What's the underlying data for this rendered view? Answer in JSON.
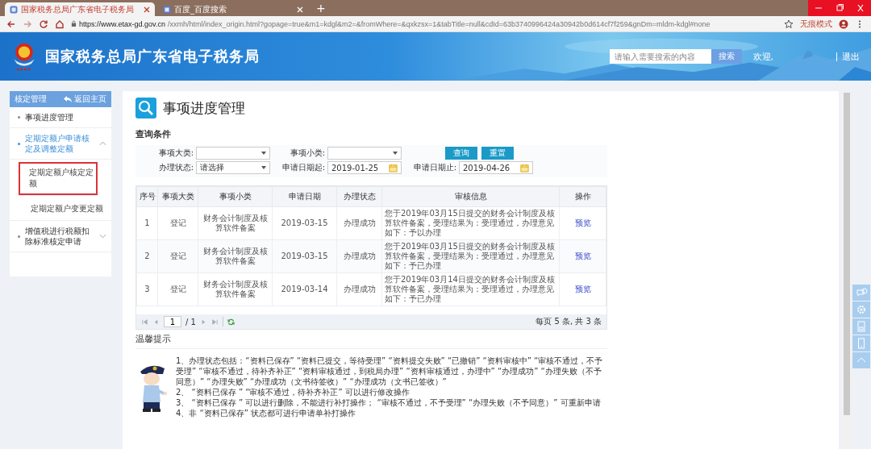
{
  "browser": {
    "tabs": [
      {
        "title": "国家税务总局广东省电子税务局",
        "selected": true
      },
      {
        "title": "百度_百度搜索",
        "selected": false
      }
    ],
    "new_tab": "+",
    "url_host": "https://www.etax-gd.gov.cn",
    "url_path": "/xxmh/html/index_origin.html?gopage=true&m1=kdgl&m2=&fromWhere=&qxkzsx=1&tabTitle=null&cdId=63b3740996424a30942b0d614cf7f259&gnDm=mldm-kdgl#none",
    "incognito": "无痕模式"
  },
  "header": {
    "title": "国家税务总局广东省电子税务局",
    "search_placeholder": "请输入需要搜索的内容",
    "search_button": "搜索",
    "welcome": "欢迎,",
    "logout": "退出"
  },
  "sidebar": {
    "title": "核定管理",
    "back": "返回主页",
    "items": [
      {
        "label": "事项进度管理",
        "selected": false
      },
      {
        "label": "定期定额户申请核定及调整定额",
        "selected": false,
        "expanded": true,
        "children": [
          {
            "label": "定期定额户核定定额",
            "selected": true
          },
          {
            "label": "定期定额户变更定额",
            "selected": false
          }
        ]
      },
      {
        "label": "增值税进行税额扣除标准核定申请",
        "selected": false,
        "expanded": false
      }
    ]
  },
  "page": {
    "title": "事项进度管理",
    "query_title": "查询条件",
    "filter_rows": [
      [
        {
          "label": "事项大类:",
          "kind": "select"
        },
        {
          "label": "事项小类:",
          "kind": "select"
        }
      ],
      [
        {
          "label": "办理状态:",
          "kind": "select",
          "value": "请选择"
        },
        {
          "label": "申请日期起:",
          "kind": "date",
          "value": "2019-01-25"
        },
        {
          "label": "申请日期止:",
          "kind": "date",
          "value": "2019-04-26"
        }
      ]
    ],
    "buttons": [
      "查询",
      "重置"
    ]
  },
  "table": {
    "columns": [
      "序号",
      "事项大类",
      "事项小类",
      "申请日期",
      "办理状态",
      "审核信息",
      "操作"
    ],
    "rows": [
      {
        "cells": [
          "1",
          "登记",
          "财务会计制度及核算软件备案",
          "2019-03-15",
          "办理成功",
          "您于2019年03月15日提交的财务会计制度及核算软件备案，受理结果为：受理通过，办理意见如下：予以办理"
        ],
        "action": "预览"
      },
      {
        "cells": [
          "2",
          "登记",
          "财务会计制度及核算软件备案",
          "2019-03-15",
          "办理成功",
          "您于2019年03月15日提交的财务会计制度及核算软件备案，受理结果为：受理通过，办理意见如下：予已办理"
        ],
        "action": "预览"
      },
      {
        "cells": [
          "3",
          "登记",
          "财务会计制度及核算软件备案",
          "2019-03-14",
          "办理成功",
          "您于2019年03月14日提交的财务会计制度及核算软件备案，受理结果为：受理通过，办理意见如下：予已办理"
        ],
        "action": "预览"
      }
    ]
  },
  "pager": {
    "page": "1",
    "total_pages": "/ 1",
    "summary": "每页 5 条, 共 3 条"
  },
  "tips": {
    "title": "温馨提示",
    "items": [
      "1、办理状态包括：“资料已保存” “资料已提交，等待受理” “资料提交失败” “已撤销” “资料审核中” “审核不通过，不予受理” “审核不通过，待补齐补正” “资料审核通过，到税局办理” “资料审核通过，办理中” “办理成功” “办理失败（不予同意）” “办理失败” “办理成功（文书待签收）” “办理成功（文书已签收）”",
      "2、 “资料已保存 ” “审核不通过，待补齐补正” 可以进行修改操作",
      "3、 “资料已保存 ” 可以进行删除，不能进行补打操作； “审核不通过，不予受理” “办理失败（不予同意）” 可重新申请",
      "4、非 “资料已保存” 状态都可进行申请单补打操作"
    ]
  }
}
